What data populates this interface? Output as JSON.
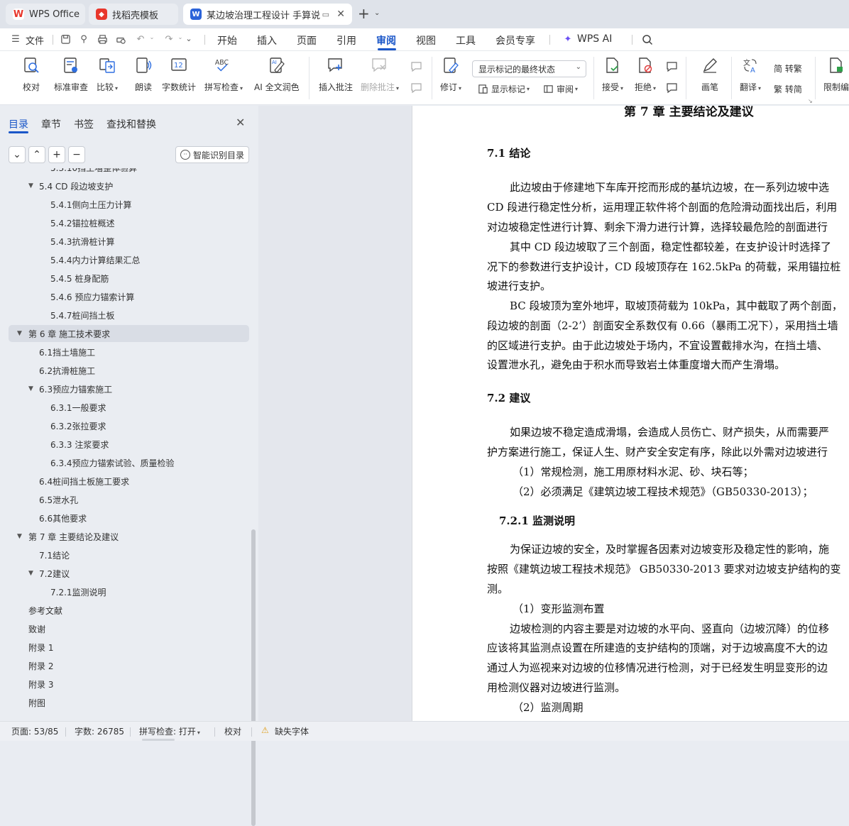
{
  "tabs": [
    {
      "label": "WPS Office",
      "icon": "wps-logo-icon",
      "color": "#e8372c"
    },
    {
      "label": "找稻壳模板",
      "icon": "docer-logo-icon",
      "color": "#e8372c"
    },
    {
      "label": "某边坡治理工程设计 手算说明",
      "icon": "wps-writer-icon",
      "color": "#2b63d9"
    }
  ],
  "menu": {
    "file": "文件",
    "items": [
      "开始",
      "插入",
      "页面",
      "引用",
      "审阅",
      "视图",
      "工具",
      "会员专享"
    ],
    "active": "审阅",
    "ai": "WPS AI"
  },
  "ribbon": {
    "proofread": "校对",
    "standard_review": "标准审查",
    "compare": "比较",
    "read_aloud": "朗读",
    "word_count": "字数统计",
    "spell_check": "拼写检查",
    "ai_polish": "AI 全文润色",
    "insert_comment": "插入批注",
    "delete_comment": "删除批注",
    "track_changes": "修订",
    "display_mode": "显示标记的最终状态",
    "show_markup": "显示标记",
    "review": "审阅",
    "accept": "接受",
    "reject": "拒绝",
    "pen": "画笔",
    "translate": "翻译",
    "to_traditional": "简 转繁",
    "to_simplified": "繁 转简",
    "restrict_edit": "限制编"
  },
  "nav": {
    "tabs": [
      "目录",
      "章节",
      "书签",
      "查找和替换"
    ],
    "active_tab": "目录",
    "smart_toc": "智能识别目录",
    "toc": [
      {
        "label": "5.3.10挡土墙整体验算",
        "level": 3,
        "expanded": null,
        "selected": false
      },
      {
        "label": "5.4  CD 段边坡支护",
        "level": 2,
        "expanded": true,
        "selected": false
      },
      {
        "label": "5.4.1侧向土压力计算",
        "level": 3,
        "expanded": null,
        "selected": false
      },
      {
        "label": "5.4.2锚拉桩概述",
        "level": 3,
        "expanded": null,
        "selected": false
      },
      {
        "label": "5.4.3抗滑桩计算",
        "level": 3,
        "expanded": null,
        "selected": false
      },
      {
        "label": "5.4.4内力计算结果汇总",
        "level": 3,
        "expanded": null,
        "selected": false
      },
      {
        "label": "5.4.5  桩身配筋",
        "level": 3,
        "expanded": null,
        "selected": false
      },
      {
        "label": "5.4.6  预应力锚索计算",
        "level": 3,
        "expanded": null,
        "selected": false
      },
      {
        "label": "5.4.7桩间挡土板",
        "level": 3,
        "expanded": null,
        "selected": false
      },
      {
        "label": "第 6 章  施工技术要求",
        "level": 1,
        "expanded": true,
        "selected": true
      },
      {
        "label": "6.1挡土墙施工",
        "level": 2,
        "expanded": null,
        "selected": false
      },
      {
        "label": "6.2抗滑桩施工",
        "level": 2,
        "expanded": null,
        "selected": false
      },
      {
        "label": "6.3预应力锚索施工",
        "level": 2,
        "expanded": true,
        "selected": false
      },
      {
        "label": "6.3.1一般要求",
        "level": 3,
        "expanded": null,
        "selected": false
      },
      {
        "label": "6.3.2张拉要求",
        "level": 3,
        "expanded": null,
        "selected": false
      },
      {
        "label": "6.3.3  注浆要求",
        "level": 3,
        "expanded": null,
        "selected": false
      },
      {
        "label": "6.3.4预应力锚索试验、质量检验",
        "level": 3,
        "expanded": null,
        "selected": false
      },
      {
        "label": "6.4桩间挡土板施工要求",
        "level": 2,
        "expanded": null,
        "selected": false
      },
      {
        "label": "6.5泄水孔",
        "level": 2,
        "expanded": null,
        "selected": false
      },
      {
        "label": "6.6其他要求",
        "level": 2,
        "expanded": null,
        "selected": false
      },
      {
        "label": "第 7 章  主要结论及建议",
        "level": 1,
        "expanded": true,
        "selected": false
      },
      {
        "label": "7.1结论",
        "level": 2,
        "expanded": null,
        "selected": false
      },
      {
        "label": "7.2建议",
        "level": 2,
        "expanded": true,
        "selected": false
      },
      {
        "label": "7.2.1监测说明",
        "level": 3,
        "expanded": null,
        "selected": false
      },
      {
        "label": "参考文献",
        "level": 1,
        "expanded": null,
        "selected": false
      },
      {
        "label": "致谢",
        "level": 1,
        "expanded": null,
        "selected": false
      },
      {
        "label": "附录 1",
        "level": 1,
        "expanded": null,
        "selected": false
      },
      {
        "label": "附录 2",
        "level": 1,
        "expanded": null,
        "selected": false
      },
      {
        "label": "附录 3",
        "level": 1,
        "expanded": null,
        "selected": false
      },
      {
        "label": "附图",
        "level": 1,
        "expanded": null,
        "selected": false
      }
    ]
  },
  "document": {
    "chapter_title": "第 7 章  主要结论及建议",
    "lines": [
      {
        "text": "7.1  结论",
        "kind": "heading"
      },
      {
        "text": "此边坡由于修建地下车库开挖而形成的基坑边坡，在一系列边坡中选",
        "kind": "indent"
      },
      {
        "text": "CD 段进行稳定性分析，运用理正软件将个剖面的危险滑动面找出后，利用",
        "kind": "body"
      },
      {
        "text": "对边坡稳定性进行计算、剩余下滑力进行计算，选择较最危险的剖面进行",
        "kind": "body"
      },
      {
        "text": "其中 CD 段边坡取了三个剖面，稳定性都较差，在支护设计时选择了",
        "kind": "indent"
      },
      {
        "text": "况下的参数进行支护设计，CD 段坡顶存在 162.5kPa 的荷载，采用锚拉桩",
        "kind": "body"
      },
      {
        "text": "坡进行支护。",
        "kind": "body"
      },
      {
        "text": "BC 段坡顶为室外地坪，取坡顶荷载为 10kPa，其中截取了两个剖面，",
        "kind": "indent"
      },
      {
        "text": "段边坡的剖面（2-2’）剖面安全系数仅有 0.66（暴雨工况下），采用挡土墙",
        "kind": "body"
      },
      {
        "text": "的区域进行支护。由于此边坡处于场内，不宜设置截排水沟，在挡土墙、",
        "kind": "body"
      },
      {
        "text": "设置泄水孔，避免由于积水而导致岩土体重度增大而产生滑塌。",
        "kind": "body"
      },
      {
        "text": "7.2  建议",
        "kind": "heading"
      },
      {
        "text": "如果边坡不稳定造成滑塌，会造成人员伤亡、财产损失，从而需要严",
        "kind": "indent"
      },
      {
        "text": "护方案进行施工，保证人生、财产安全安定有序，除此以外需对边坡进行",
        "kind": "body"
      },
      {
        "text": "（1）常规检测，施工用原材料水泥、砂、块石等；",
        "kind": "list"
      },
      {
        "text": "（2）必须满足《建筑边坡工程技术规范》（GB50330-2013）；",
        "kind": "list"
      },
      {
        "text": "7.2.1  监测说明",
        "kind": "subheading"
      },
      {
        "text": "为保证边坡的安全，及时掌握各因素对边坡变形及稳定性的影响，施",
        "kind": "indent"
      },
      {
        "text": "按照《建筑边坡工程技术规范》 GB50330-2013 要求对边坡支护结构的变",
        "kind": "body"
      },
      {
        "text": "测。",
        "kind": "body"
      },
      {
        "text": "（1）变形监测布置",
        "kind": "list"
      },
      {
        "text": "边坡检测的内容主要是对边坡的水平向、竖直向（边坡沉降）的位移",
        "kind": "indent"
      },
      {
        "text": "应该将其监测点设置在所建造的支护结构的顶端，对于边坡高度不大的边",
        "kind": "body"
      },
      {
        "text": "通过人为巡视来对边坡的位移情况进行检测，对于已经发生明显变形的边",
        "kind": "body"
      },
      {
        "text": "用检测仪器对边坡进行监测。",
        "kind": "body"
      },
      {
        "text": "（2）监测周期",
        "kind": "list"
      }
    ]
  },
  "status": {
    "page": "页面: 53/85",
    "words": "字数: 26785",
    "spell": "拼写检查: 打开",
    "proof": "校对",
    "missing_font": "缺失字体"
  },
  "colors": {
    "accent": "#1a56c8",
    "warning": "#f0a020"
  }
}
